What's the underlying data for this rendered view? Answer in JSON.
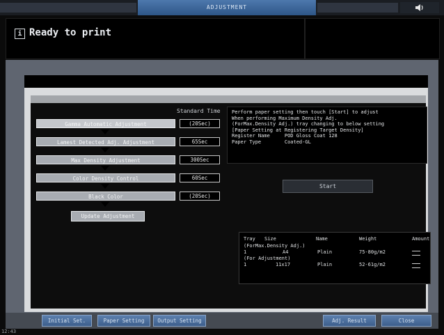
{
  "header": {
    "title": "ADJUSTMENT",
    "sound_icon": "speaker-icon"
  },
  "status": {
    "icon": "info-icon",
    "icon_glyph": "i",
    "text": "Ready to print"
  },
  "column_header": "Standard Time",
  "steps": [
    {
      "label": "Gamma Automatic Adjustment",
      "time": "(20Sec)",
      "selected": true
    },
    {
      "label": "Lamest Detected Adj. Adjustment",
      "time": "65Sec",
      "selected": false
    },
    {
      "label": "Max Density Adjustment",
      "time": "300Sec",
      "selected": false
    },
    {
      "label": "Color Density Control",
      "time": "60Sec",
      "selected": false
    },
    {
      "label": "Black Color",
      "time": "(20Sec)",
      "selected": false
    }
  ],
  "update_button": "Update Adjustment",
  "message": {
    "lines": [
      "Perform paper setting then touch [Start] to adjust",
      "When performing Maximum Density Adj.",
      "(ForMax.Density Adj.) tray changing to below setting",
      "[Paper Setting at Registering Target Density]",
      "Register Name     POD Gloss Coat 128",
      "Paper Type        Coated-GL"
    ]
  },
  "start_button": "Start",
  "tray_table": {
    "headers": [
      "Tray",
      "Size",
      "Name",
      "Weight",
      "Amount"
    ],
    "rows": [
      {
        "text": "(ForMax.Density Adj.)"
      },
      {
        "tray": "1",
        "size": "A4",
        "name": "Plain",
        "weight": "75-80g/m2",
        "amount": true
      },
      {
        "text": "(For Adjustment)"
      },
      {
        "tray": "1",
        "size": "11x17",
        "name": "Plain",
        "weight": "52-61g/m2",
        "amount": true
      }
    ]
  },
  "bottom_buttons": {
    "initial_set": "Initial Set.",
    "paper_setting": "Paper Setting",
    "output_setting": "Output Setting",
    "adj_result": "Adj. Result",
    "close": "Close"
  },
  "footer_time": "12:43",
  "colors": {
    "title_tab": "#3f6a9e",
    "panel": "#dadcde",
    "button_blue": "#4a6f9f"
  }
}
